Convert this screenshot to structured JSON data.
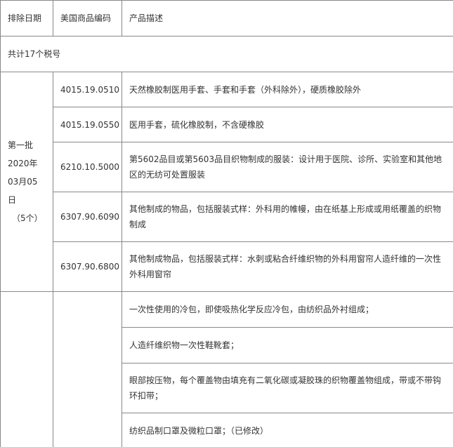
{
  "table": {
    "headers": {
      "date": "排除日期",
      "code": "美国商品编码",
      "desc": "产品描述"
    },
    "total": "共计17个税号",
    "batch1": {
      "label": "第一批",
      "year": "2020年",
      "date": "03月05日",
      "count": "（5个）",
      "rows": [
        {
          "code": "4015.19.0510",
          "desc": "天然橡胶制医用手套、手套和手套（外科除外），硬质橡胶除外"
        },
        {
          "code": "4015.19.0550",
          "desc": "医用手套，硫化橡胶制，不含硬橡胶"
        },
        {
          "code": "6210.10.5000",
          "desc": "第5602品目或第5603品目织物制成的服装：设计用于医院、诊所、实验室和其他地区的无纺可处置服装"
        },
        {
          "code": "6307.90.6090",
          "desc": "其他制成的物品，包括服装式样：外科用的帷幔，由在纸基上形成或用纸覆盖的织物制成"
        },
        {
          "code": "6307.90.6800",
          "desc": "其他制成物品，包括服装式样：水刺或粘合纤维织物的外科用窗帘人造纤维的一次性外科用窗帘"
        }
      ]
    },
    "batch2": {
      "rows": [
        {
          "desc": "一次性使用的冷包，即使吸热化学反应冷包，由纺织品外衬组成；"
        },
        {
          "desc": "人造纤维织物一次性鞋靴套；"
        },
        {
          "desc": "眼部按压物，每个覆盖物由填充有二氧化碳或凝胶珠的织物覆盖物组成，带或不带钩环扣带；"
        },
        {
          "desc": "纺织品制口罩及微粒口罩；（已修改）"
        }
      ]
    }
  }
}
